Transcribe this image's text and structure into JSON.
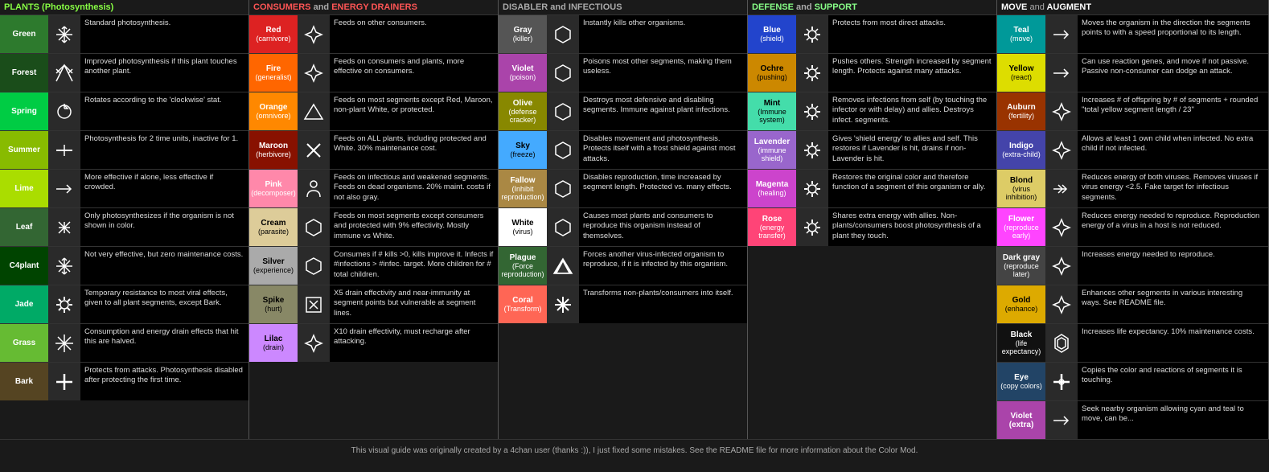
{
  "columns": [
    {
      "id": "plants",
      "header": "PLANTS (Photosynthesis)",
      "headerColor": "#88ff44",
      "entries": [
        {
          "name": "Green",
          "sub": "",
          "color": "bg-green",
          "icon": "snowflake",
          "text": "Standard photosynthesis."
        },
        {
          "name": "Forest",
          "sub": "",
          "color": "bg-forest",
          "icon": "branch",
          "text": "Improved photosynthesis if this plant touches another plant."
        },
        {
          "name": "Spring",
          "sub": "",
          "color": "bg-spring",
          "icon": "rotate",
          "text": "Rotates according to the 'clockwise' stat."
        },
        {
          "name": "Summer",
          "sub": "",
          "color": "bg-summer",
          "icon": "dash",
          "text": "Photosynthesis for 2 time units, inactive for 1."
        },
        {
          "name": "Lime",
          "sub": "",
          "color": "bg-lime",
          "icon": "arrow-single",
          "text": "More effective if alone, less effective if crowded."
        },
        {
          "name": "Leaf",
          "sub": "",
          "color": "bg-leaf",
          "icon": "x4",
          "text": "Only photosynthesizes if the organism is not shown in color."
        },
        {
          "name": "C4plant",
          "sub": "",
          "color": "bg-c4plant",
          "icon": "snowflake",
          "text": "Not very effective, but zero maintenance costs."
        },
        {
          "name": "Jade",
          "sub": "",
          "color": "bg-jade",
          "icon": "gear",
          "text": "Temporary resistance to most viral effects, given to all plant segments, except Bark."
        },
        {
          "name": "Grass",
          "sub": "",
          "color": "bg-grass",
          "icon": "snowflake2",
          "text": "Consumption and energy drain effects that hit this are halved."
        },
        {
          "name": "Bark",
          "sub": "",
          "color": "bg-bark",
          "icon": "cross",
          "text": "Protects from attacks. Photosynthesis disabled after protecting the first time."
        }
      ]
    },
    {
      "id": "consumers",
      "header": "CONSUMERS and ENERGY DRAINERS",
      "headerColor": "#ff5555",
      "entries": [
        {
          "name": "Red",
          "sub": "(carnivore)",
          "color": "bg-red",
          "icon": "star4",
          "text": "Feeds on other consumers."
        },
        {
          "name": "Fire",
          "sub": "(generalist)",
          "color": "bg-fire",
          "icon": "star4",
          "text": "Feeds on consumers and plants, more effective on consumers."
        },
        {
          "name": "Orange",
          "sub": "(omnivore)",
          "color": "bg-orange",
          "icon": "triangle",
          "text": "Feeds on most segments except Red, Maroon, non-plant White, or protected."
        },
        {
          "name": "Maroon",
          "sub": "(herbivore)",
          "color": "bg-maroon",
          "icon": "x-mark",
          "text": "Feeds on ALL plants, including protected and White. 30% maintenance cost."
        },
        {
          "name": "Pink",
          "sub": "(decomposer)",
          "color": "bg-pink",
          "icon": "person",
          "text": "Feeds on infectious and weakened segments. Feeds on dead organisms. 20% maint. costs if not also gray."
        },
        {
          "name": "Cream",
          "sub": "(parasite)",
          "color": "bg-cream",
          "icon": "hex",
          "text": "Feeds on most segments except consumers and protected with 9% effectivity. Mostly immune vs White."
        },
        {
          "name": "Silver",
          "sub": "(experience)",
          "color": "bg-silver",
          "icon": "hex",
          "text": "Consumes if # kills >0, kills improve it. Infects if #infections > #infec. target. More children for # total children."
        },
        {
          "name": "Spike",
          "sub": "(hurt)",
          "color": "bg-spike",
          "icon": "square-x",
          "text": "X5 drain effectivity and near-immunity at segment points but vulnerable at segment lines."
        },
        {
          "name": "Lilac",
          "sub": "(drain)",
          "color": "bg-lilac",
          "icon": "star4",
          "text": "X10 drain effectivity, must recharge after attacking."
        }
      ]
    },
    {
      "id": "disabler",
      "header": "DISABLER and INFECTIOUS",
      "headerColor": "#aaaaaa",
      "entries": [
        {
          "name": "Gray",
          "sub": "(killer)",
          "color": "bg-gray",
          "icon": "hex",
          "text": "Instantly kills other organisms."
        },
        {
          "name": "Violet",
          "sub": "(poison)",
          "color": "bg-violet",
          "icon": "hex",
          "text": "Poisons most other segments, making them useless."
        },
        {
          "name": "Olive",
          "sub": "(defense cracker)",
          "color": "bg-olive",
          "icon": "hex",
          "text": "Destroys most defensive and disabling segments. Immune against plant infections."
        },
        {
          "name": "Sky",
          "sub": "(freeze)",
          "color": "bg-sky",
          "icon": "hex",
          "text": "Disables movement and photosynthesis. Protects itself with a frost shield against most attacks."
        },
        {
          "name": "Fallow",
          "sub": "(Inhibit reproduction)",
          "color": "bg-fallow",
          "icon": "hex",
          "text": "Disables reproduction, time increased by segment length. Protected vs. many effects."
        },
        {
          "name": "White",
          "sub": "(virus)",
          "color": "bg-white",
          "icon": "hex",
          "text": "Causes most plants and consumers to reproduce this organism instead of themselves."
        },
        {
          "name": "Plague",
          "sub": "(Force reproduction)",
          "color": "bg-plague",
          "icon": "triangle2",
          "text": "Forces another virus-infected organism to reproduce, if it is infected by this organism."
        },
        {
          "name": "Coral",
          "sub": "(Transform)",
          "color": "bg-coral",
          "icon": "x-cross",
          "text": "Transforms non-plants/consumers into itself."
        }
      ]
    },
    {
      "id": "defense",
      "header": "DEFENSE and SUPPORT",
      "headerColor": "#88ff88",
      "entries": [
        {
          "name": "Blue",
          "sub": "(shield)",
          "color": "bg-blue",
          "icon": "gear2",
          "text": "Protects from most direct attacks."
        },
        {
          "name": "Ochre",
          "sub": "(pushing)",
          "color": "bg-ochre",
          "icon": "gear2",
          "text": "Pushes others. Strength increased by segment length. Protects against many attacks."
        },
        {
          "name": "Mint",
          "sub": "(Immune system)",
          "color": "bg-mint",
          "icon": "gear2",
          "text": "Removes infections from self (by touching the infector or with delay) and allies. Destroys infect. segments."
        },
        {
          "name": "Lavender",
          "sub": "(immune shield)",
          "color": "bg-lavender",
          "icon": "gear2",
          "text": "Gives 'shield energy' to allies and self. This restores if Lavender is hit, drains if non-Lavender is hit."
        },
        {
          "name": "Magenta",
          "sub": "(healing)",
          "color": "bg-magenta",
          "icon": "gear2",
          "text": "Restores the original color and therefore function of a segment of this organism or ally."
        },
        {
          "name": "Rose",
          "sub": "(energy transfer)",
          "color": "bg-rose",
          "icon": "gear2",
          "text": "Shares extra energy with allies. Non-plants/consumers boost photosynthesis of a plant they touch."
        }
      ]
    },
    {
      "id": "move",
      "header": "MOVE and AUGMENT",
      "headerColor": "#ffffff",
      "entries": [
        {
          "name": "Teal",
          "sub": "(move)",
          "color": "bg-teal",
          "icon": "arrow-r",
          "text": "Moves the organism in the direction the segments points to with a speed proportional to its length."
        },
        {
          "name": "Yellow",
          "sub": "(react)",
          "color": "bg-yellow",
          "icon": "arrow-r",
          "text": "Can use reaction genes, and move if not passive. Passive non-consumer can dodge an attack."
        },
        {
          "name": "Auburn",
          "sub": "(fertility)",
          "color": "bg-auburn",
          "icon": "star4",
          "text": "Increases # of offspring by # of segments + rounded \"total yellow segment length / 23\""
        },
        {
          "name": "Indigo",
          "sub": "(extra-child)",
          "color": "bg-indigo",
          "icon": "star4",
          "text": "Allows at least 1 own child when infected. No extra child if not infected."
        },
        {
          "name": "Blond",
          "sub": "(virus inhibition)",
          "color": "bg-blond",
          "icon": "arrow-r2",
          "text": "Reduces energy of both viruses. Removes viruses if virus energy <2.5. Fake target for infectious segments."
        },
        {
          "name": "Flower",
          "sub": "(reproduce early)",
          "color": "bg-flower",
          "icon": "star4",
          "text": "Reduces energy needed to reproduce. Reproduction energy of a virus in a host is not reduced."
        },
        {
          "name": "Dark gray",
          "sub": "(reproduce later)",
          "color": "bg-darkgray",
          "icon": "star4",
          "text": "Increases energy needed to reproduce."
        },
        {
          "name": "Gold",
          "sub": "(enhance)",
          "color": "bg-gold",
          "icon": "star4",
          "text": "Enhances other segments in various interesting ways. See README file."
        },
        {
          "name": "Black",
          "sub": "(life expectancy)",
          "color": "bg-black",
          "icon": "hex3",
          "text": "Increases life expectancy. 10% maintenance costs."
        },
        {
          "name": "Eye",
          "sub": "(copy colors)",
          "color": "bg-eye",
          "icon": "cross2",
          "text": "Copies the color and reactions of segments it is touching."
        },
        {
          "name": "Violet (extra)",
          "sub": "",
          "color": "bg-violet",
          "icon": "arrow-r",
          "text": "Seek nearby organism allowing cyan and teal to move, can be..."
        }
      ]
    }
  ],
  "footer": "This visual guide was originally created by a 4chan user (thanks :)), I just fixed some mistakes. See the README file for more information about the Color Mod."
}
